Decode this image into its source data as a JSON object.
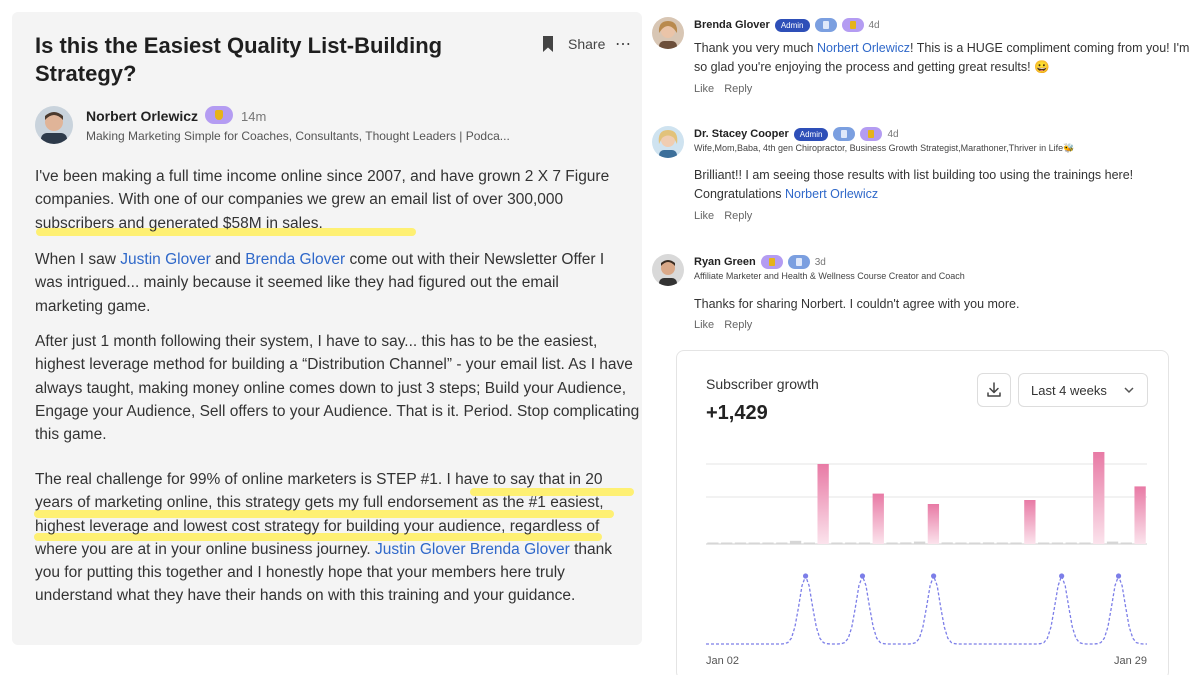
{
  "post": {
    "title": "Is this the Easiest Quality List-Building Strategy?",
    "share_label": "Share",
    "more_label": "⋯",
    "author": {
      "name": "Norbert Orlewicz",
      "time": "14m",
      "bio": "Making Marketing Simple for Coaches, Consultants, Thought Leaders | Podca..."
    },
    "p1": "I've been making a full time income online since 2007, and have grown 2 X 7 Figure companies. With one of our companies we grew an email list of over 300,000 subscribers and generated $58M in sales.",
    "p2": {
      "before": "When I saw ",
      "mention1": "Justin Glover",
      "mid": " and ",
      "mention2": "Brenda Glover",
      "after": " come out with their Newsletter Offer I was intrigued... mainly because it seemed like they had figured out the email marketing game."
    },
    "p3": "After just 1 month following their system, I have to say... this has to be the easiest, highest leverage method for building a “Distribution Channel” - your email list. As I have always taught, making money online comes down to just 3 steps; Build your Audience, Engage your Audience, Sell offers to your Audience. That is it. Period. Stop complicating this game.",
    "p4": {
      "before": "The real challenge for 99% of online marketers is STEP #1. I have to say that in 20 years of marketing online, this strategy gets my full endorsement as the #1 easiest, highest leverage and lowest cost strategy for building your audience, regardless of where you are at in your online business journey. ",
      "mention1": "Justin Glover",
      "mid": " ",
      "mention2": "Brenda Glover",
      "after": " thank you for putting this together and I honestly hope that your members here truly understand what they have their hands on with this training and your guidance."
    }
  },
  "comments": [
    {
      "name": "Brenda Glover",
      "admin": "Admin",
      "time": "4d",
      "subtitle": "",
      "body_before": "Thank you very much ",
      "mention": "Norbert Orlewicz",
      "body_after": "! This is a HUGE compliment coming from you! I'm so glad you're enjoying the process and getting great results! 😀",
      "like": "Like",
      "reply": "Reply"
    },
    {
      "name": "Dr. Stacey Cooper",
      "admin": "Admin",
      "time": "4d",
      "subtitle": "Wife,Mom,Baba, 4th gen Chiropractor, Business Growth Strategist,Marathoner,Thriver in Life🐝",
      "body_before": "Brilliant!! I am seeing those results with list building too using the trainings here! Congratulations ",
      "mention": "Norbert Orlewicz",
      "body_after": "",
      "like": "Like",
      "reply": "Reply"
    },
    {
      "name": "Ryan Green",
      "time": "3d",
      "subtitle": "Affiliate Marketer and Health & Wellness Course Creator and Coach",
      "body_before": "Thanks for sharing Norbert. I couldn't agree with you more.",
      "mention": "",
      "body_after": "",
      "like": "Like",
      "reply": "Reply"
    }
  ],
  "card": {
    "title": "Subscriber growth",
    "value": "+1,429",
    "range": "Last 4 weeks"
  },
  "chart_data": {
    "type": "bar",
    "x_labels": [
      "Jan 02",
      "Jan 29"
    ],
    "bar_values": [
      0,
      0,
      0,
      0,
      0,
      0,
      0.04,
      0.01,
      1.0,
      0.01,
      0,
      0,
      0.63,
      0.01,
      0.02,
      0.03,
      0.5,
      0.02,
      0,
      0,
      0.02,
      0,
      0,
      0.55,
      0.01,
      0,
      0,
      0.01,
      1.15,
      0.03,
      0,
      0.72
    ],
    "line_peaks_days": [
      7,
      11,
      16,
      25,
      29
    ],
    "colors": {
      "bar": "#e87aa5",
      "line": "#7c7ee8",
      "grid": "#e5e5e5"
    }
  }
}
